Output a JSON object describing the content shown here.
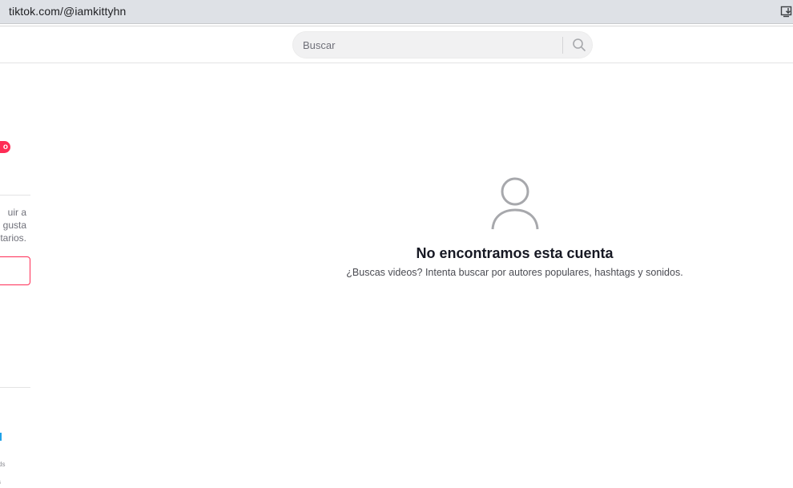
{
  "browser": {
    "url": "tiktok.com/@iamkittyhn"
  },
  "header": {
    "search": {
      "placeholder": "Buscar"
    }
  },
  "sidebar": {
    "badge_fragment": "o",
    "login_text_lines": [
      "uir a",
      "gusta",
      "tarios."
    ],
    "footer_fragments": [
      "ds",
      "s"
    ]
  },
  "main": {
    "empty_title": "No encontramos esta cuenta",
    "empty_description": "¿Buscas videos? Intenta buscar por autores populares, hashtags y sonidos."
  },
  "colors": {
    "brand_red": "#fe2c55",
    "text_primary": "#161823",
    "search_bg": "#f1f1f2"
  }
}
